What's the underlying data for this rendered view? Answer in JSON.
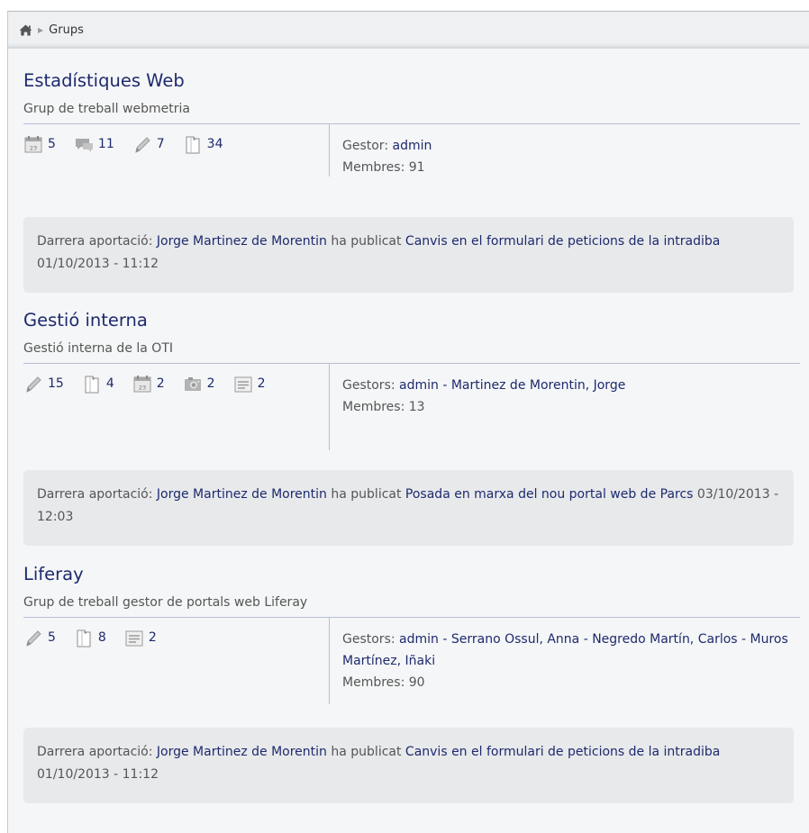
{
  "breadcrumb": {
    "current": "Grups"
  },
  "groups": [
    {
      "title": "Estadístiques Web",
      "description": "Grup de treball webmetria",
      "stats": [
        {
          "icon": "calendar-icon",
          "value": "5"
        },
        {
          "icon": "comments-icon",
          "value": "11"
        },
        {
          "icon": "pencil-icon",
          "value": "7"
        },
        {
          "icon": "document-icon",
          "value": "34"
        }
      ],
      "managers_label": "Gestor:",
      "managers": "admin",
      "members_label": "Membres:",
      "members": "91",
      "last_label": "Darrera aportació:",
      "last_author": "Jorge Martinez de Morentin",
      "last_action": "ha publicat",
      "last_title": "Canvis en el formulari de peticions de la intradiba",
      "last_date": "01/10/2013 - 11:12"
    },
    {
      "title": "Gestió interna",
      "description": "Gestió interna de la OTI",
      "stats": [
        {
          "icon": "pencil-icon",
          "value": "15"
        },
        {
          "icon": "document-icon",
          "value": "4"
        },
        {
          "icon": "calendar-icon",
          "value": "2"
        },
        {
          "icon": "camera-icon",
          "value": "2"
        },
        {
          "icon": "list-icon",
          "value": "2"
        }
      ],
      "managers_label": "Gestors:",
      "managers": "admin - Martinez de Morentin, Jorge",
      "members_label": "Membres:",
      "members": "13",
      "last_label": "Darrera aportació:",
      "last_author": "Jorge Martinez de Morentin",
      "last_action": "ha publicat",
      "last_title": "Posada en marxa del nou portal web de Parcs",
      "last_date": "03/10/2013 - 12:03"
    },
    {
      "title": "Liferay",
      "description": "Grup de treball gestor de portals web Liferay",
      "stats": [
        {
          "icon": "pencil-icon",
          "value": "5"
        },
        {
          "icon": "document-icon",
          "value": "8"
        },
        {
          "icon": "list-icon",
          "value": "2"
        }
      ],
      "managers_label": "Gestors:",
      "managers": "admin - Serrano Ossul, Anna - Negredo Martín, Carlos - Muros Martínez, Iñaki",
      "members_label": "Membres:",
      "members": "90",
      "last_label": "Darrera aportació:",
      "last_author": "Jorge Martinez de Morentin",
      "last_action": "ha publicat",
      "last_title": "Canvis en el formulari de peticions de la intradiba",
      "last_date": "01/10/2013 - 11:12"
    }
  ]
}
